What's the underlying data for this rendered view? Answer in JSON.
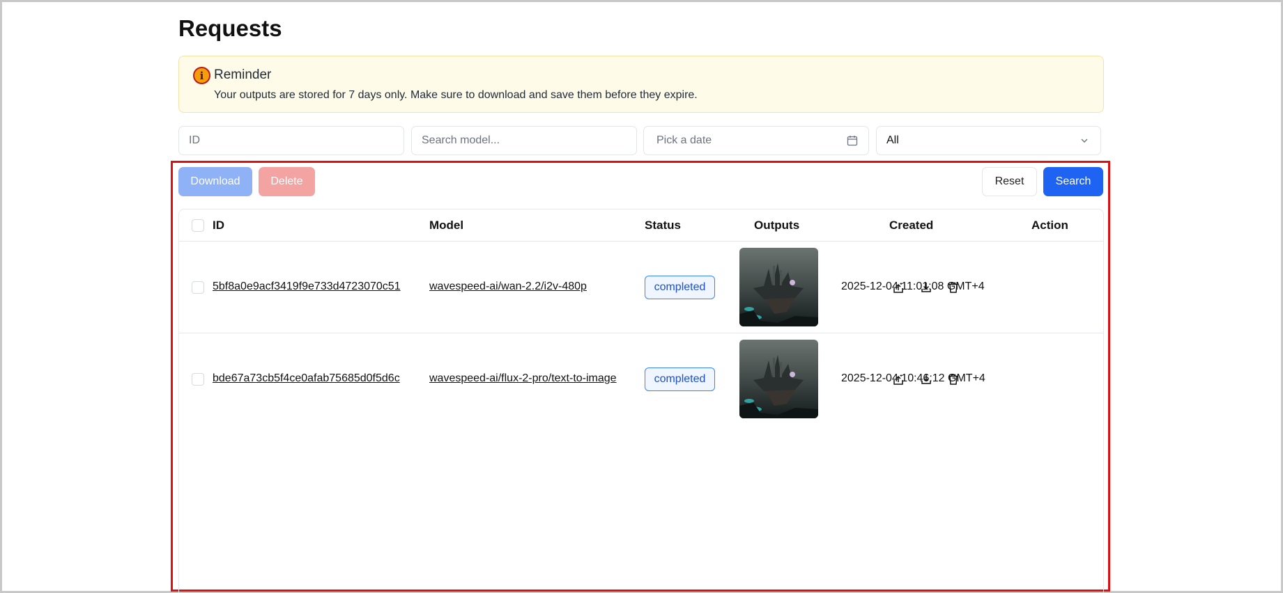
{
  "page": {
    "title": "Requests"
  },
  "reminder": {
    "icon": "info-icon",
    "title": "Reminder",
    "text": "Your outputs are stored for 7 days only. Make sure to download and save them before they expire."
  },
  "filters": {
    "id_placeholder": "ID",
    "model_placeholder": "Search model...",
    "date_placeholder": "Pick a date",
    "status_value": "All"
  },
  "toolbar": {
    "download_label": "Download",
    "delete_label": "Delete",
    "reset_label": "Reset",
    "search_label": "Search"
  },
  "table": {
    "columns": [
      "ID",
      "Model",
      "Status",
      "Outputs",
      "Created",
      "Action"
    ],
    "rows": [
      {
        "id": "5bf8a0e9acf3419f9e733d4723070c51",
        "model": "wavespeed-ai/wan-2.2/i2v-480p",
        "status": "completed",
        "created": "2025-12-04 11:01:08 GMT+4"
      },
      {
        "id": "bde67a73cb5f4ce0afab75685d0f5d6c",
        "model": "wavespeed-ai/flux-2-pro/text-to-image",
        "status": "completed",
        "created": "2025-12-04 10:46:12 GMT+4"
      }
    ]
  },
  "colors": {
    "primary": "#1e63f1",
    "download_disabled": "#8fb1f6",
    "delete_disabled": "#f4a3a3",
    "reminder_bg": "#fefbe8",
    "badge_blue": "#1d4ed8",
    "highlight": "#e01010"
  }
}
